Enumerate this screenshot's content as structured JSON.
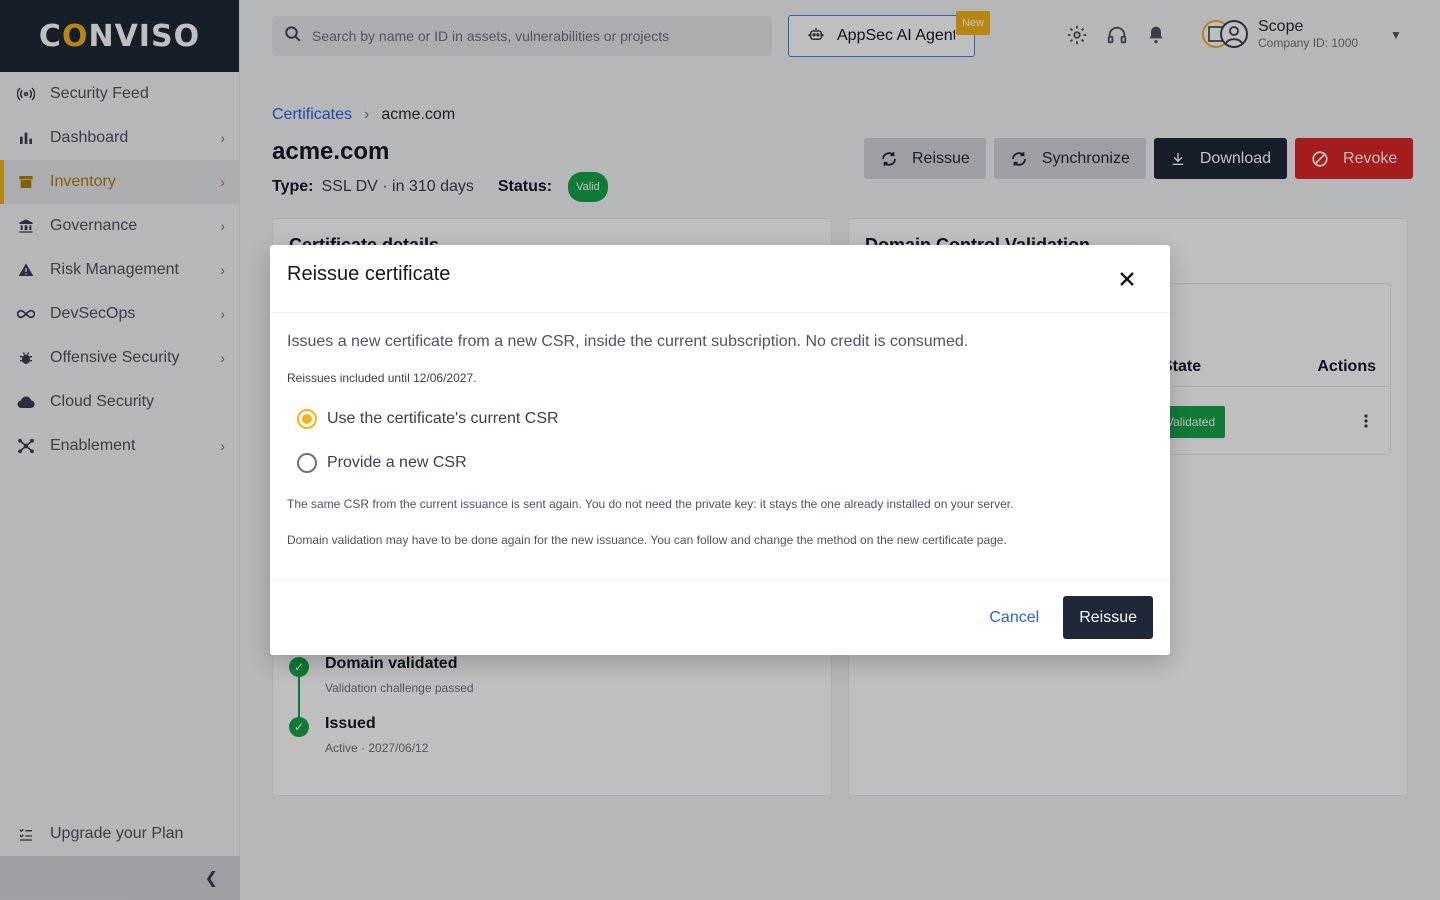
{
  "brand": {
    "name": "CONVISO",
    "accent": "#f5b315"
  },
  "sidebar": {
    "items": [
      {
        "label": "Security Feed",
        "icon": "broadcast-icon"
      },
      {
        "label": "Dashboard",
        "icon": "bar-chart-icon"
      },
      {
        "label": "Inventory",
        "icon": "archive-icon",
        "active": true
      },
      {
        "label": "Governance",
        "icon": "bank-icon"
      },
      {
        "label": "Risk Management",
        "icon": "warning-icon"
      },
      {
        "label": "DevSecOps",
        "icon": "infinity-icon"
      },
      {
        "label": "Offensive Security",
        "icon": "bug-icon"
      },
      {
        "label": "Cloud Security",
        "icon": "cloud-icon"
      },
      {
        "label": "Enablement",
        "icon": "hub-icon"
      }
    ],
    "upgrade_label": "Upgrade your Plan"
  },
  "topbar": {
    "search_placeholder": "Search by name or ID in assets, vulnerabilities or projects",
    "ai_label": "AppSec AI Agent",
    "ai_badge": "New",
    "scope_title": "Scope",
    "scope_sub": "Company ID: 1000"
  },
  "page": {
    "breadcrumb_root": "Certificates",
    "breadcrumb_current": "acme.com",
    "title": "acme.com",
    "type_label": "Type:",
    "type_value": "SSL DV · in 310 days",
    "status_label": "Status:",
    "status_value": "Valid",
    "actions": {
      "reissue": "Reissue",
      "sync": "Synchronize",
      "download": "Download",
      "revoke": "Revoke"
    }
  },
  "left_card": {
    "title": "Certificate details",
    "timeline": [
      {
        "title": "Domain validated",
        "sub": "Validation challenge passed"
      },
      {
        "title": "Issued",
        "sub": "Active · 2027/06/12"
      }
    ]
  },
  "right_card": {
    "title": "Domain Control Validation",
    "col_state": "State",
    "col_actions": "Actions",
    "row_state": "Validated"
  },
  "modal": {
    "title": "Reissue certificate",
    "lead": "Issues a new certificate from a new CSR, inside the current subscription. No credit is consumed.",
    "included": "Reissues included until 12/06/2027.",
    "option_current": "Use the certificate's current CSR",
    "option_new": "Provide a new CSR",
    "note1": "The same CSR from the current issuance is sent again. You do not need the private key: it stays the one already installed on your server.",
    "note2": "Domain validation may have to be done again for the new issuance. You can follow and change the method on the new certificate page.",
    "cancel": "Cancel",
    "confirm": "Reissue"
  }
}
